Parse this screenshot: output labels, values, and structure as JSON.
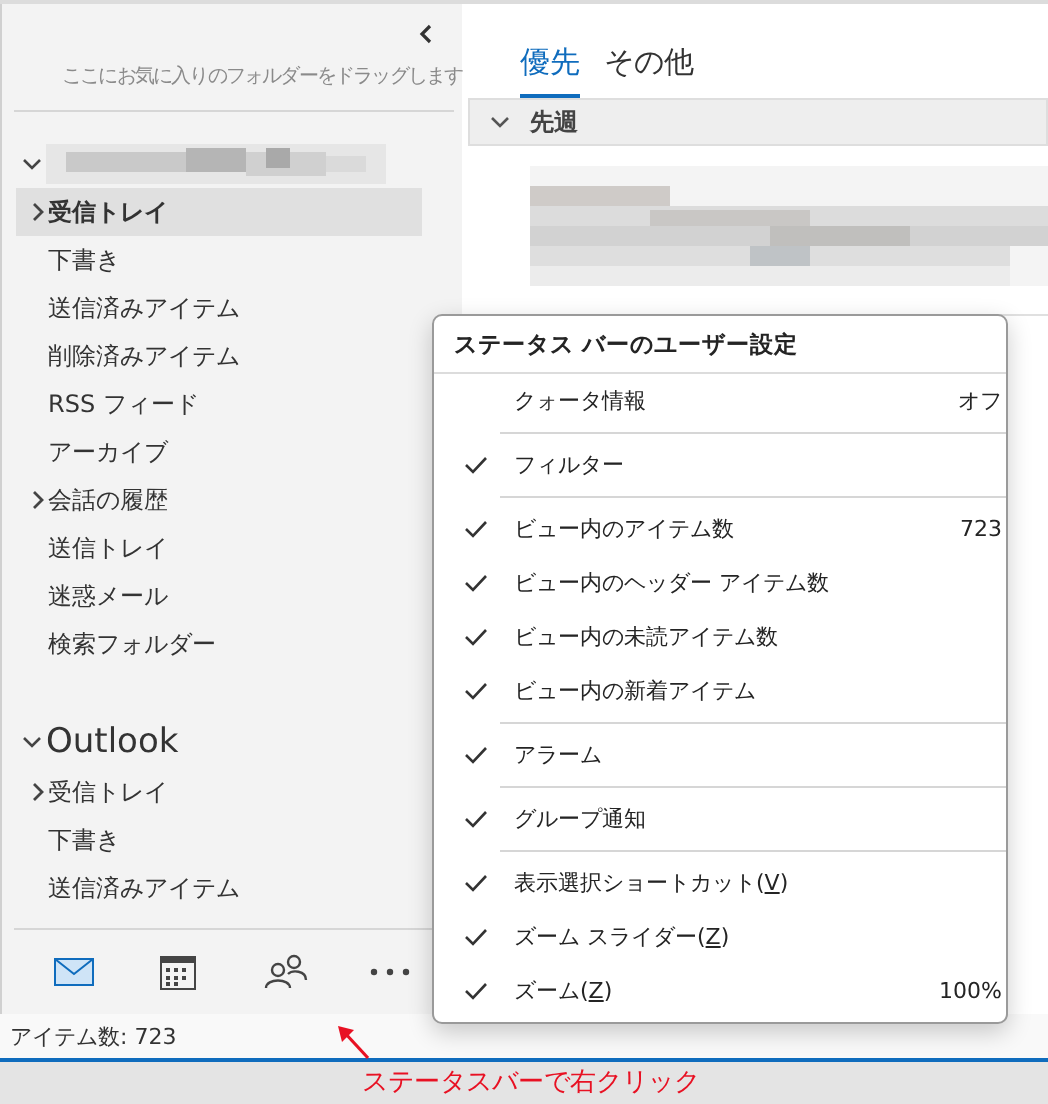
{
  "sidebar": {
    "favorites_hint": "ここにお気に入りのフォルダーをドラッグします",
    "accounts": [
      {
        "kind": "picture",
        "expanded": true,
        "children": [
          {
            "label": "受信トレイ",
            "expanded": false,
            "selected": true
          },
          {
            "label": "下書き",
            "selected": false
          },
          {
            "label": "送信済みアイテム",
            "selected": false
          },
          {
            "label": "削除済みアイテム",
            "selected": false
          },
          {
            "label": "RSS フィード",
            "selected": false
          },
          {
            "label": "アーカイブ",
            "selected": false
          },
          {
            "label": "会話の履歴",
            "expanded": false,
            "selected": false
          },
          {
            "label": "送信トレイ",
            "selected": false
          },
          {
            "label": "迷惑メール",
            "selected": false
          },
          {
            "label": "検索フォルダー",
            "selected": false
          }
        ]
      },
      {
        "name": "Outlook",
        "expanded": true,
        "children": [
          {
            "label": "受信トレイ",
            "expanded": false,
            "selected": false
          },
          {
            "label": "下書き",
            "selected": false
          },
          {
            "label": "送信済みアイテム",
            "selected": false
          }
        ]
      }
    ],
    "nav": [
      {
        "kind": "mail",
        "selected": true
      },
      {
        "kind": "calendar",
        "selected": false
      },
      {
        "kind": "people",
        "selected": false
      },
      {
        "kind": "more",
        "selected": false
      }
    ]
  },
  "message_list": {
    "tabs": [
      {
        "label": "優先",
        "selected": true
      },
      {
        "label": "その他",
        "selected": false
      }
    ],
    "group": {
      "label": "先週",
      "expanded": true
    }
  },
  "context_menu": {
    "title": "ステータス バーのユーザー設定",
    "items": [
      {
        "label": "クォータ情報",
        "checked": false,
        "value": "オフ"
      },
      {
        "kind": "separator"
      },
      {
        "label": "フィルター",
        "checked": true
      },
      {
        "kind": "separator"
      },
      {
        "label": "ビュー内のアイテム数",
        "checked": true,
        "value": "723"
      },
      {
        "label": "ビュー内のヘッダー アイテム数",
        "checked": true
      },
      {
        "label": "ビュー内の未読アイテム数",
        "checked": true
      },
      {
        "label": "ビュー内の新着アイテム",
        "checked": true
      },
      {
        "kind": "separator"
      },
      {
        "label": "アラーム",
        "checked": true
      },
      {
        "kind": "separator"
      },
      {
        "label": "グループ通知",
        "checked": true
      },
      {
        "kind": "separator"
      },
      {
        "label": "表示選択ショートカット(",
        "accesskey": "V",
        "label_end": ")",
        "checked": true
      },
      {
        "label": "ズーム スライダー(",
        "accesskey": "Z",
        "label_end": ")",
        "checked": true
      },
      {
        "label": "ズーム(",
        "accesskey": "Z",
        "label_end": ")",
        "checked": true,
        "value": "100%"
      }
    ]
  },
  "status_bar": {
    "text": "アイテム数: 723"
  },
  "annotation": {
    "text": "ステータスバーで右クリック"
  }
}
